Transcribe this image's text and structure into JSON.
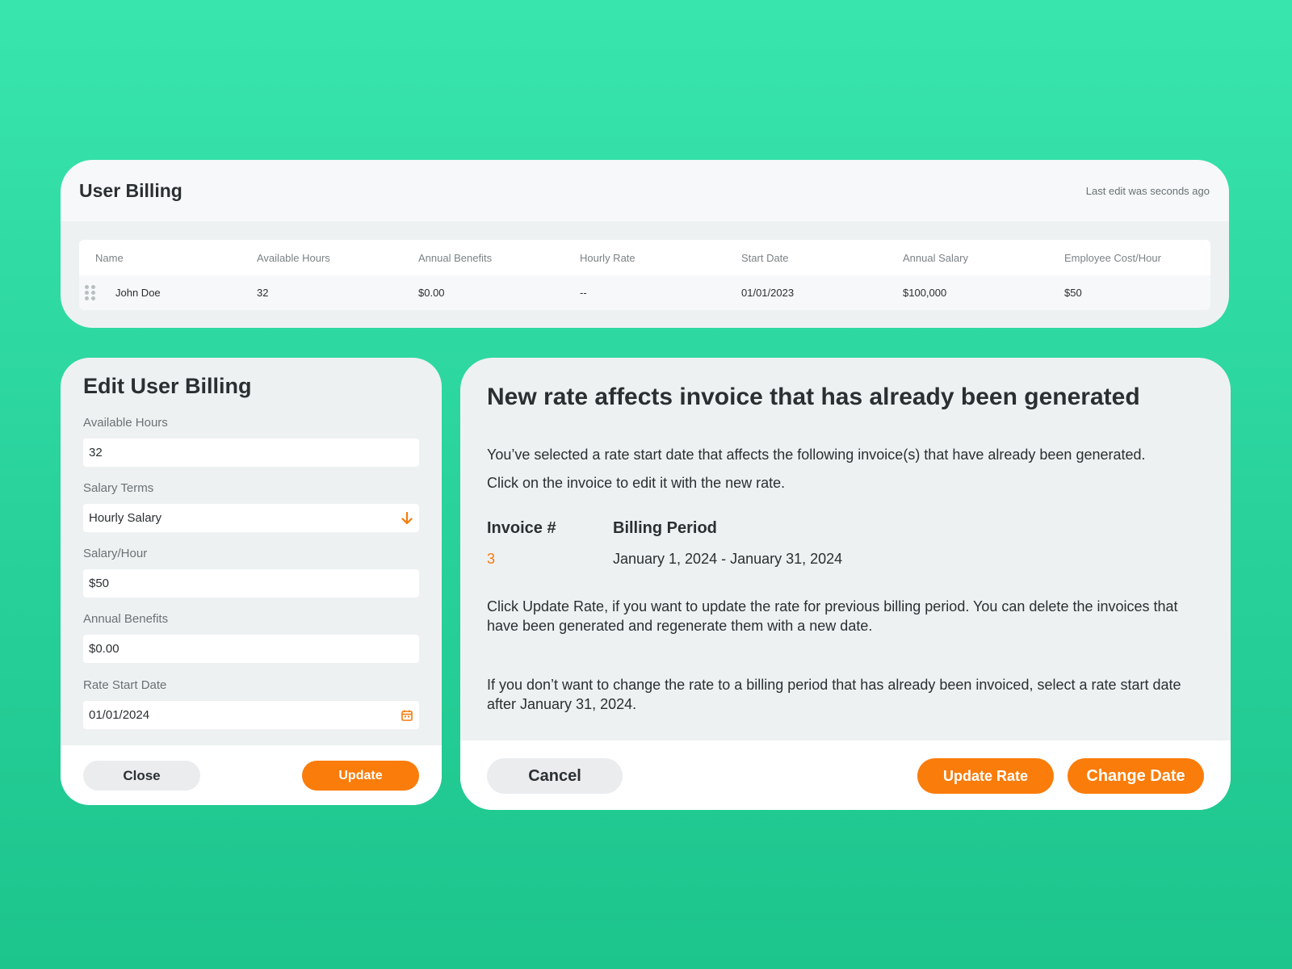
{
  "user_billing": {
    "title": "User Billing",
    "last_edit": "Last edit was seconds ago",
    "columns": [
      "Name",
      "Available Hours",
      "Annual Benefits",
      "Hourly Rate",
      "Start Date",
      "Annual Salary",
      "Employee Cost/Hour"
    ],
    "rows": [
      [
        "John Doe",
        "32",
        "$0.00",
        "--",
        "01/01/2023",
        "$100,000",
        "$50"
      ]
    ]
  },
  "edit_billing": {
    "title": "Edit User Billing",
    "fields": [
      {
        "label": "Available Hours",
        "value": "32",
        "icon": ""
      },
      {
        "label": "Salary Terms",
        "value": "Hourly Salary",
        "icon": "arrow-down-icon"
      },
      {
        "label": "Salary/Hour",
        "value": "$50",
        "icon": ""
      },
      {
        "label": "Annual Benefits",
        "value": "$0.00",
        "icon": ""
      },
      {
        "label": "Rate Start Date",
        "value": "01/01/2024",
        "icon": "calendar-icon"
      }
    ],
    "close_label": "Close",
    "update_label": "Update"
  },
  "rate_warning": {
    "title": "New rate affects invoice that has already been generated",
    "line1": "You’ve selected a rate start date that affects the following invoice(s) that have already been generated.",
    "line2": "Click on the invoice to edit it with the new rate.",
    "invoice_header": "Invoice #",
    "period_header": "Billing Period",
    "invoice_number": "3",
    "billing_period": "January 1, 2024 - January 31, 2024",
    "para1": "Click Update Rate, if you want to update the rate for previous billing period. You can delete the invoices that have been generated and regenerate them with a new date.",
    "para2": "If you don’t want to change the rate to a billing period that has already been invoiced, select a rate start date after January 31, 2024.",
    "cancel_label": "Cancel",
    "update_rate_label": "Update Rate",
    "change_date_label": "Change Date"
  },
  "colors": {
    "accent": "#fa7c0a",
    "background_top": "#38e6ad",
    "background_bottom": "#1cc58c",
    "text": "#2b2f31"
  }
}
